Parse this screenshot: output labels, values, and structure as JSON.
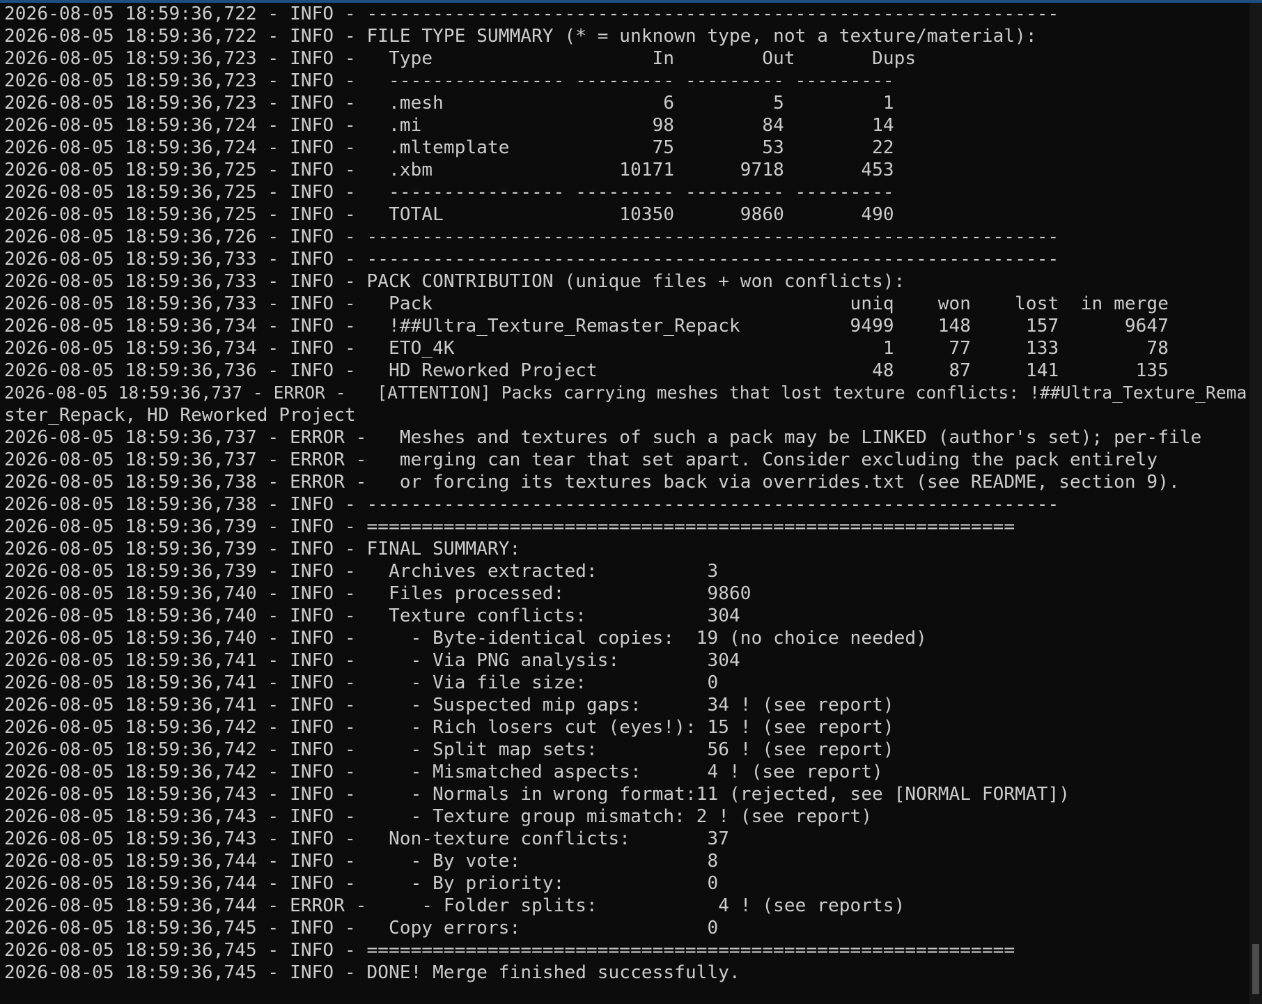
{
  "colors": {
    "background": "#0c0c0c",
    "text": "#cccccc",
    "window_border": "#1f4f82"
  },
  "scrollbar": {
    "thumb_position": 0.99,
    "thumb_fraction": 0.05
  },
  "lines": [
    "2026-08-05 18:59:36,722 - INFO - ---------------------------------------------------------------",
    "2026-08-05 18:59:36,722 - INFO - FILE TYPE SUMMARY (* = unknown type, not a texture/material):",
    "2026-08-05 18:59:36,723 - INFO -   Type                    In        Out       Dups",
    "2026-08-05 18:59:36,723 - INFO -   ---------------- --------- --------- ---------",
    "2026-08-05 18:59:36,723 - INFO -   .mesh                    6         5         1",
    "2026-08-05 18:59:36,724 - INFO -   .mi                     98        84        14",
    "2026-08-05 18:59:36,724 - INFO -   .mltemplate             75        53        22",
    "2026-08-05 18:59:36,725 - INFO -   .xbm                 10171      9718       453",
    "2026-08-05 18:59:36,725 - INFO -   ---------------- --------- --------- ---------",
    "2026-08-05 18:59:36,725 - INFO -   TOTAL                10350      9860       490",
    "2026-08-05 18:59:36,726 - INFO - ---------------------------------------------------------------",
    "2026-08-05 18:59:36,733 - INFO - ---------------------------------------------------------------",
    "2026-08-05 18:59:36,733 - INFO - PACK CONTRIBUTION (unique files + won conflicts):",
    "2026-08-05 18:59:36,733 - INFO -   Pack                                      uniq    won    lost  in merge",
    "2026-08-05 18:59:36,734 - INFO -   !##Ultra_Texture_Remaster_Repack          9499    148     157      9647",
    "2026-08-05 18:59:36,734 - INFO -   ETO_4K                                       1     77     133        78",
    "2026-08-05 18:59:36,736 - INFO -   HD Reworked Project                         48     87     141       135",
    "2026-08-05 18:59:36,737 - ERROR -   [ATTENTION] Packs carrying meshes that lost texture conflicts: !##Ultra_Texture_Rema",
    "ster_Repack, HD Reworked Project",
    "2026-08-05 18:59:36,737 - ERROR -   Meshes and textures of such a pack may be LINKED (author's set); per-file",
    "2026-08-05 18:59:36,737 - ERROR -   merging can tear that set apart. Consider excluding the pack entirely",
    "2026-08-05 18:59:36,738 - ERROR -   or forcing its textures back via overrides.txt (see README, section 9).",
    "2026-08-05 18:59:36,738 - INFO - ---------------------------------------------------------------",
    "2026-08-05 18:59:36,739 - INFO - ===========================================================",
    "2026-08-05 18:59:36,739 - INFO - FINAL SUMMARY:",
    "2026-08-05 18:59:36,739 - INFO -   Archives extracted:          3",
    "2026-08-05 18:59:36,740 - INFO -   Files processed:             9860",
    "2026-08-05 18:59:36,740 - INFO -   Texture conflicts:           304",
    "2026-08-05 18:59:36,740 - INFO -     - Byte-identical copies:  19 (no choice needed)",
    "2026-08-05 18:59:36,741 - INFO -     - Via PNG analysis:        304",
    "2026-08-05 18:59:36,741 - INFO -     - Via file size:           0",
    "2026-08-05 18:59:36,741 - INFO -     - Suspected mip gaps:      34 ! (see report)",
    "2026-08-05 18:59:36,742 - INFO -     - Rich losers cut (eyes!): 15 ! (see report)",
    "2026-08-05 18:59:36,742 - INFO -     - Split map sets:          56 ! (see report)",
    "2026-08-05 18:59:36,742 - INFO -     - Mismatched aspects:      4 ! (see report)",
    "2026-08-05 18:59:36,743 - INFO -     - Normals in wrong format:11 (rejected, see [NORMAL FORMAT])",
    "2026-08-05 18:59:36,743 - INFO -     - Texture group mismatch: 2 ! (see report)",
    "2026-08-05 18:59:36,743 - INFO -   Non-texture conflicts:       37",
    "2026-08-05 18:59:36,744 - INFO -     - By vote:                 8",
    "2026-08-05 18:59:36,744 - INFO -     - By priority:             0",
    "2026-08-05 18:59:36,744 - ERROR -     - Folder splits:           4 ! (see reports)",
    "2026-08-05 18:59:36,745 - INFO -   Copy errors:                 0",
    "2026-08-05 18:59:36,745 - INFO - ===========================================================",
    "2026-08-05 18:59:36,745 - INFO - DONE! Merge finished successfully."
  ]
}
